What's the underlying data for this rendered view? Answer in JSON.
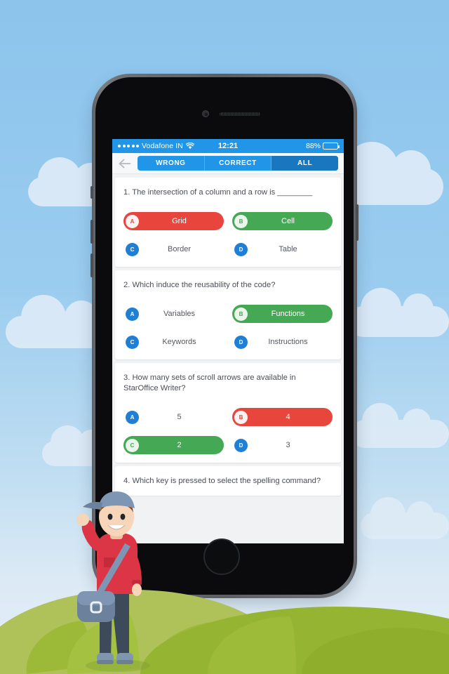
{
  "statusbar": {
    "carrier": "Vodafone IN",
    "time": "12:21",
    "battery_percent": "88%",
    "battery_level": 88,
    "signal_dots": 5,
    "wifi_icon": "wifi-icon",
    "battery_icon": "battery-icon"
  },
  "navbar": {
    "back_icon": "back-arrow-icon",
    "tabs": [
      {
        "label": "WRONG",
        "active": false
      },
      {
        "label": "CORRECT",
        "active": false
      },
      {
        "label": "ALL",
        "active": true
      }
    ]
  },
  "colors": {
    "accent_blue": "#2196E8",
    "active_tab_blue": "#1877BF",
    "wrong_red": "#E8453C",
    "correct_green": "#45A854",
    "badge_blue": "#1E7FD4",
    "screen_bg": "#F1F2F4",
    "card_white": "#FFFFFF",
    "sky_blue": "#8CC4EC",
    "grass_green": "#95B432"
  },
  "questions": [
    {
      "number": "1.",
      "text": "1. The intersection of a column and a row is ________",
      "options": [
        {
          "letter": "A",
          "label": "Grid",
          "state": "wrong"
        },
        {
          "letter": "B",
          "label": "Cell",
          "state": "correct"
        },
        {
          "letter": "C",
          "label": "Border",
          "state": "neutral"
        },
        {
          "letter": "D",
          "label": "Table",
          "state": "neutral"
        }
      ]
    },
    {
      "number": "2.",
      "text": "2. Which induce the reusability of the code?",
      "options": [
        {
          "letter": "A",
          "label": "Variables",
          "state": "neutral"
        },
        {
          "letter": "B",
          "label": "Functions",
          "state": "correct"
        },
        {
          "letter": "C",
          "label": "Keywords",
          "state": "neutral"
        },
        {
          "letter": "D",
          "label": "Instructions",
          "state": "neutral"
        }
      ]
    },
    {
      "number": "3.",
      "text": "3. How many sets of scroll arrows are available in StarOffice Writer?",
      "options": [
        {
          "letter": "A",
          "label": "5",
          "state": "neutral"
        },
        {
          "letter": "B",
          "label": "4",
          "state": "wrong"
        },
        {
          "letter": "C",
          "label": "2",
          "state": "correct"
        },
        {
          "letter": "D",
          "label": "3",
          "state": "neutral"
        }
      ]
    },
    {
      "number": "4.",
      "text": "4. Which key is pressed to select the spelling command?",
      "options": []
    }
  ],
  "illustration": {
    "character": "waving-boy",
    "cap_color": "#7E96B3",
    "shirt_color": "#DC3545",
    "pants_color": "#3C4A5A",
    "bag_color": "#7E96B3",
    "skin_color": "#F6D5B8"
  }
}
